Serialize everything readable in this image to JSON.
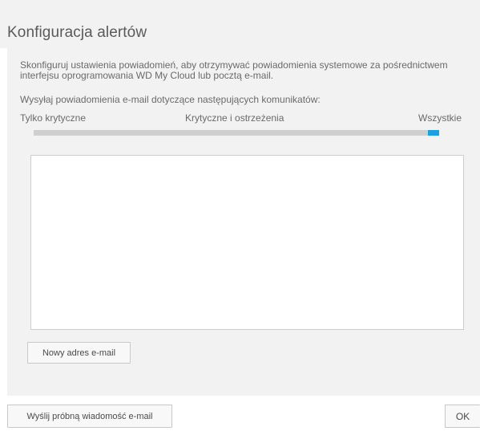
{
  "dialog": {
    "title": "Konfiguracja alertów",
    "description": "Skonfiguruj ustawienia powiadomień, aby otrzymywać powiadomienia systemowe za pośrednictwem interfejsu oprogramowania WD My Cloud lub pocztą e-mail.",
    "send_label": "Wysyłaj powiadomienia e-mail dotyczące następujących komunikatów:"
  },
  "alert_level": {
    "options": [
      "Tylko krytyczne",
      "Krytyczne i ostrzeżenia",
      "Wszystkie"
    ],
    "selected": "Wszystkie",
    "selected_fraction": 1.0,
    "track_color": "#cfcfcf",
    "thumb_color": "#1ba1e2"
  },
  "email_list": {
    "items": []
  },
  "buttons": {
    "new_email": "Nowy adres e-mail",
    "send_test": "Wyślij próbną wiadomość e-mail",
    "ok": "OK"
  }
}
